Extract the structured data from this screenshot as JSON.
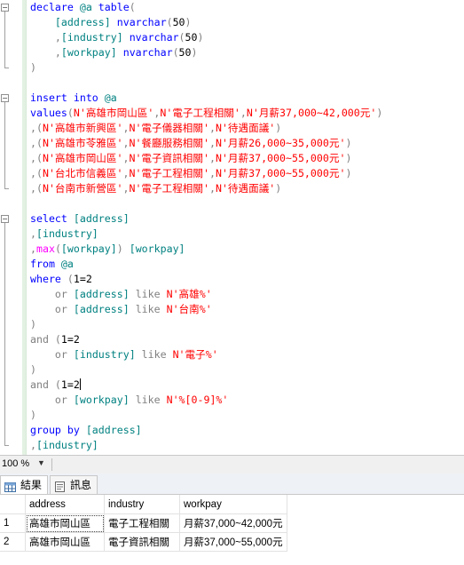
{
  "editor": {
    "lines": [
      {
        "segs": [
          [
            "kw",
            "declare "
          ],
          [
            "id",
            "@a "
          ],
          [
            "kw",
            "table"
          ],
          [
            "op",
            "("
          ]
        ],
        "fold": "open"
      },
      {
        "segs": [
          [
            "pl",
            "    "
          ],
          [
            "id",
            "[address] "
          ],
          [
            "kw",
            "nvarchar"
          ],
          [
            "op",
            "("
          ],
          [
            "pl",
            "50"
          ],
          [
            "op",
            ")"
          ]
        ],
        "fold": "line"
      },
      {
        "segs": [
          [
            "pl",
            "    "
          ],
          [
            "op",
            ","
          ],
          [
            "id",
            "[industry] "
          ],
          [
            "kw",
            "nvarchar"
          ],
          [
            "op",
            "("
          ],
          [
            "pl",
            "50"
          ],
          [
            "op",
            ")"
          ]
        ],
        "fold": "line"
      },
      {
        "segs": [
          [
            "pl",
            "    "
          ],
          [
            "op",
            ","
          ],
          [
            "id",
            "[workpay] "
          ],
          [
            "kw",
            "nvarchar"
          ],
          [
            "op",
            "("
          ],
          [
            "pl",
            "50"
          ],
          [
            "op",
            ")"
          ]
        ],
        "fold": "line"
      },
      {
        "segs": [
          [
            "op",
            ")"
          ]
        ],
        "fold": "end"
      },
      {
        "segs": [],
        "fold": ""
      },
      {
        "segs": [
          [
            "kw",
            "insert into "
          ],
          [
            "id",
            "@a"
          ]
        ],
        "fold": "open"
      },
      {
        "segs": [
          [
            "kw",
            "values"
          ],
          [
            "op",
            "("
          ],
          [
            "str",
            "N'高雄市岡山區'"
          ],
          [
            "op",
            ","
          ],
          [
            "str",
            "N'電子工程相關'"
          ],
          [
            "op",
            ","
          ],
          [
            "str",
            "N'月薪37,000~42,000元'"
          ],
          [
            "op",
            ")"
          ]
        ],
        "fold": "line"
      },
      {
        "segs": [
          [
            "op",
            ",("
          ],
          [
            "str",
            "N'高雄市新興區'"
          ],
          [
            "op",
            ","
          ],
          [
            "str",
            "N'電子儀器相關'"
          ],
          [
            "op",
            ","
          ],
          [
            "str",
            "N'待遇面議'"
          ],
          [
            "op",
            ")"
          ]
        ],
        "fold": "line"
      },
      {
        "segs": [
          [
            "op",
            ",("
          ],
          [
            "str",
            "N'高雄市苓雅區'"
          ],
          [
            "op",
            ","
          ],
          [
            "str",
            "N'餐廳服務相關'"
          ],
          [
            "op",
            ","
          ],
          [
            "str",
            "N'月薪26,000~35,000元'"
          ],
          [
            "op",
            ")"
          ]
        ],
        "fold": "line"
      },
      {
        "segs": [
          [
            "op",
            ",("
          ],
          [
            "str",
            "N'高雄市岡山區'"
          ],
          [
            "op",
            ","
          ],
          [
            "str",
            "N'電子資訊相關'"
          ],
          [
            "op",
            ","
          ],
          [
            "str",
            "N'月薪37,000~55,000元'"
          ],
          [
            "op",
            ")"
          ]
        ],
        "fold": "line"
      },
      {
        "segs": [
          [
            "op",
            ",("
          ],
          [
            "str",
            "N'台北市信義區'"
          ],
          [
            "op",
            ","
          ],
          [
            "str",
            "N'電子工程相關'"
          ],
          [
            "op",
            ","
          ],
          [
            "str",
            "N'月薪37,000~55,000元'"
          ],
          [
            "op",
            ")"
          ]
        ],
        "fold": "line"
      },
      {
        "segs": [
          [
            "op",
            ",("
          ],
          [
            "str",
            "N'台南市新營區'"
          ],
          [
            "op",
            ","
          ],
          [
            "str",
            "N'電子工程相關'"
          ],
          [
            "op",
            ","
          ],
          [
            "str",
            "N'待遇面議'"
          ],
          [
            "op",
            ")"
          ]
        ],
        "fold": "end"
      },
      {
        "segs": [],
        "fold": ""
      },
      {
        "segs": [
          [
            "kw",
            "select "
          ],
          [
            "id",
            "[address]"
          ]
        ],
        "fold": "open"
      },
      {
        "segs": [
          [
            "op",
            ","
          ],
          [
            "id",
            "[industry]"
          ]
        ],
        "fold": "line"
      },
      {
        "segs": [
          [
            "op",
            ","
          ],
          [
            "fn",
            "max"
          ],
          [
            "op",
            "("
          ],
          [
            "id",
            "[workpay]"
          ],
          [
            "op",
            ") "
          ],
          [
            "id",
            "[workpay]"
          ]
        ],
        "fold": "line"
      },
      {
        "segs": [
          [
            "kw",
            "from "
          ],
          [
            "id",
            "@a"
          ]
        ],
        "fold": "line"
      },
      {
        "segs": [
          [
            "kw",
            "where "
          ],
          [
            "op",
            "("
          ],
          [
            "pl",
            "1=2"
          ]
        ],
        "fold": "line"
      },
      {
        "segs": [
          [
            "pl",
            "    "
          ],
          [
            "op",
            "or "
          ],
          [
            "id",
            "[address] "
          ],
          [
            "op",
            "like "
          ],
          [
            "str",
            "N'高雄%'"
          ]
        ],
        "fold": "line"
      },
      {
        "segs": [
          [
            "pl",
            "    "
          ],
          [
            "op",
            "or "
          ],
          [
            "id",
            "[address] "
          ],
          [
            "op",
            "like "
          ],
          [
            "str",
            "N'台南%'"
          ]
        ],
        "fold": "line"
      },
      {
        "segs": [
          [
            "op",
            ")"
          ]
        ],
        "fold": "line"
      },
      {
        "segs": [
          [
            "op",
            "and "
          ],
          [
            "op",
            "("
          ],
          [
            "pl",
            "1=2"
          ]
        ],
        "fold": "line"
      },
      {
        "segs": [
          [
            "pl",
            "    "
          ],
          [
            "op",
            "or "
          ],
          [
            "id",
            "[industry] "
          ],
          [
            "op",
            "like "
          ],
          [
            "str",
            "N'電子%'"
          ]
        ],
        "fold": "line"
      },
      {
        "segs": [
          [
            "op",
            ")"
          ]
        ],
        "fold": "line"
      },
      {
        "segs": [
          [
            "op",
            "and "
          ],
          [
            "op",
            "("
          ],
          [
            "pl",
            "1=2"
          ]
        ],
        "fold": "line",
        "caret": true
      },
      {
        "segs": [
          [
            "pl",
            "    "
          ],
          [
            "op",
            "or "
          ],
          [
            "id",
            "[workpay] "
          ],
          [
            "op",
            "like "
          ],
          [
            "str",
            "N'%[0-9]%'"
          ]
        ],
        "fold": "line"
      },
      {
        "segs": [
          [
            "op",
            ")"
          ]
        ],
        "fold": "line"
      },
      {
        "segs": [
          [
            "kw",
            "group by "
          ],
          [
            "id",
            "[address]"
          ]
        ],
        "fold": "line"
      },
      {
        "segs": [
          [
            "op",
            ","
          ],
          [
            "id",
            "[industry]"
          ]
        ],
        "fold": "end"
      }
    ]
  },
  "zoom": {
    "value": "100 %"
  },
  "tabs": {
    "results": "結果",
    "messages": "訊息"
  },
  "grid": {
    "columns": [
      "address",
      "industry",
      "workpay"
    ],
    "rows": [
      {
        "n": "1",
        "cells": [
          "高雄市岡山區",
          "電子工程相關",
          "月薪37,000~42,000元"
        ]
      },
      {
        "n": "2",
        "cells": [
          "高雄市岡山區",
          "電子資訊相關",
          "月薪37,000~55,000元"
        ]
      }
    ]
  },
  "colors": {
    "keyword": "#0000ff",
    "identifier": "#008080",
    "string": "#ff0000",
    "function": "#ff00ff",
    "operator": "#808080"
  }
}
